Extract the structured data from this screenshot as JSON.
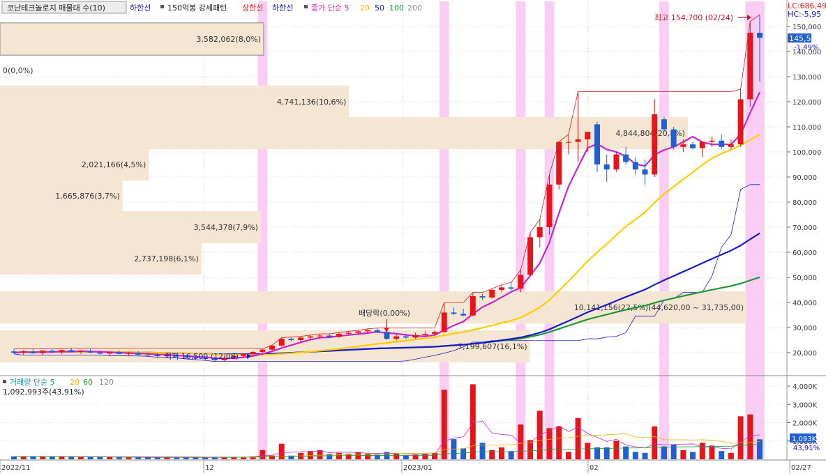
{
  "legend_main": {
    "title": "코난테크놀로지 매물대 수(10)",
    "item_low_line": "하한선",
    "item_150": "150억봉 강세패턴",
    "item_upper": "상한선",
    "item_lower": "하한선",
    "item_close": "종가 단순 5",
    "ma20": "20",
    "ma50": "50",
    "ma100": "100",
    "ma200": "200"
  },
  "legend_volume": {
    "title": "거래량 단순 5",
    "ma20": "20",
    "ma60": "60",
    "ma120": "120",
    "current": "1,092,993주(43,91%)"
  },
  "corner": {
    "lc": "LC:686,49",
    "hc": "HC:-5,95"
  },
  "price_axis": {
    "ticks": [
      "150,000",
      "140,000",
      "130,000",
      "120,000",
      "110,000",
      "100,000",
      "90,000",
      "80,000",
      "70,000",
      "60,000",
      "50,000",
      "40,000",
      "30,000",
      "20,000"
    ],
    "current_price": "145,500",
    "current_change": "-1,49%"
  },
  "volume_axis": {
    "ticks": [
      "4,000K",
      "3,000K",
      "2,000K",
      "1,000K"
    ],
    "current_volume": "1,093K",
    "current_pct": "43,91%"
  },
  "date_axis": {
    "labels": [
      "2022/11",
      "12",
      "2023/01",
      "02",
      "02/27"
    ]
  },
  "volume_profile_labels": [
    "3,582,062(8,0%)",
    "0(0,0%)",
    "4,741,136(10,6%)",
    "4,844,804(20,8%)",
    "2,021,166(4,5%)",
    "1,665,876(3,7%)",
    "3,544,378(7,9%)",
    "2,737,198(6,1%)",
    "10,141,156(22,5%)(44,620,00 ~ 31,735,00)",
    "7,199,607(16,1%)"
  ],
  "annotations": {
    "high": "최고 154,700 (02/24)",
    "low": "최저 16,500 (12/08)",
    "dividend": "배당락(0,00%)"
  },
  "colors": {
    "up": "#e8141a",
    "down": "#1f5fd1",
    "profile": "#f5e6d3",
    "highlight": "#f9c4f3",
    "ma5": "#cc22cc",
    "ma20": "#ffcc00",
    "ma50": "#1a1acc",
    "ma100": "#1a9933",
    "ma200": "#888888"
  },
  "chart_data": {
    "type": "candlestick",
    "date_range": [
      "2022/11",
      "02/27"
    ],
    "ylim": [
      15000,
      160000
    ],
    "volume_ylim": [
      0,
      4500
    ],
    "volume_unit": "K",
    "volume_profile": [
      {
        "price": 145000,
        "volume": 3582062,
        "pct": 8.0
      },
      {
        "price": 132500,
        "volume": 0,
        "pct": 0.0
      },
      {
        "price": 120000,
        "volume": 4741136,
        "pct": 10.6
      },
      {
        "price": 107500,
        "volume": 9344804,
        "pct": 20.8
      },
      {
        "price": 95000,
        "volume": 2021166,
        "pct": 4.5
      },
      {
        "price": 82500,
        "volume": 1665876,
        "pct": 3.7
      },
      {
        "price": 70000,
        "volume": 3544378,
        "pct": 7.9
      },
      {
        "price": 57500,
        "volume": 2737198,
        "pct": 6.1
      },
      {
        "price": 38000,
        "volume": 10141156,
        "pct": 22.5
      },
      {
        "price": 22500,
        "volume": 7199607,
        "pct": 16.1
      }
    ],
    "candles": [
      {
        "o": 20500,
        "h": 21500,
        "l": 19500,
        "c": 20000,
        "v": 150
      },
      {
        "o": 20000,
        "h": 21000,
        "l": 19000,
        "c": 20500,
        "v": 160
      },
      {
        "o": 20500,
        "h": 21500,
        "l": 19500,
        "c": 19800,
        "v": 140
      },
      {
        "o": 19800,
        "h": 21000,
        "l": 19000,
        "c": 20800,
        "v": 170
      },
      {
        "o": 20800,
        "h": 21500,
        "l": 19800,
        "c": 20200,
        "v": 130
      },
      {
        "o": 20200,
        "h": 21200,
        "l": 19500,
        "c": 21000,
        "v": 150
      },
      {
        "o": 21000,
        "h": 21800,
        "l": 20000,
        "c": 20300,
        "v": 140
      },
      {
        "o": 20300,
        "h": 21000,
        "l": 19500,
        "c": 20700,
        "v": 120
      },
      {
        "o": 20700,
        "h": 21500,
        "l": 19800,
        "c": 20000,
        "v": 130
      },
      {
        "o": 20000,
        "h": 20800,
        "l": 19200,
        "c": 19600,
        "v": 125
      },
      {
        "o": 19600,
        "h": 20500,
        "l": 18800,
        "c": 20200,
        "v": 115
      },
      {
        "o": 20200,
        "h": 20900,
        "l": 19300,
        "c": 19500,
        "v": 110
      },
      {
        "o": 19500,
        "h": 20300,
        "l": 18700,
        "c": 19900,
        "v": 105
      },
      {
        "o": 19900,
        "h": 20600,
        "l": 19000,
        "c": 19200,
        "v": 100
      },
      {
        "o": 19200,
        "h": 20000,
        "l": 18500,
        "c": 19000,
        "v": 95
      },
      {
        "o": 19000,
        "h": 19800,
        "l": 18200,
        "c": 18600,
        "v": 100
      },
      {
        "o": 18600,
        "h": 19500,
        "l": 17900,
        "c": 19100,
        "v": 110
      },
      {
        "o": 19100,
        "h": 19800,
        "l": 18300,
        "c": 18500,
        "v": 90
      },
      {
        "o": 18500,
        "h": 19200,
        "l": 17500,
        "c": 18100,
        "v": 100
      },
      {
        "o": 18100,
        "h": 18800,
        "l": 17200,
        "c": 17800,
        "v": 95
      },
      {
        "o": 17800,
        "h": 18500,
        "l": 16900,
        "c": 17600,
        "v": 90
      },
      {
        "o": 17600,
        "h": 18300,
        "l": 16500,
        "c": 17000,
        "v": 120
      },
      {
        "o": 17000,
        "h": 18200,
        "l": 16700,
        "c": 17900,
        "v": 110
      },
      {
        "o": 17900,
        "h": 18900,
        "l": 17400,
        "c": 18700,
        "v": 120
      },
      {
        "o": 18700,
        "h": 19800,
        "l": 18200,
        "c": 19500,
        "v": 130
      },
      {
        "o": 19500,
        "h": 20500,
        "l": 18900,
        "c": 20300,
        "v": 150
      },
      {
        "o": 20300,
        "h": 21500,
        "l": 19800,
        "c": 21200,
        "v": 500
      },
      {
        "o": 21200,
        "h": 23000,
        "l": 20800,
        "c": 22800,
        "v": 200
      },
      {
        "o": 22800,
        "h": 26000,
        "l": 22300,
        "c": 25500,
        "v": 850
      },
      {
        "o": 25500,
        "h": 26200,
        "l": 24500,
        "c": 25000,
        "v": 200
      },
      {
        "o": 25000,
        "h": 26500,
        "l": 24200,
        "c": 26000,
        "v": 350
      },
      {
        "o": 26000,
        "h": 27000,
        "l": 25000,
        "c": 26500,
        "v": 450
      },
      {
        "o": 26500,
        "h": 27500,
        "l": 25500,
        "c": 26800,
        "v": 500
      },
      {
        "o": 26800,
        "h": 27500,
        "l": 25800,
        "c": 26300,
        "v": 300
      },
      {
        "o": 26300,
        "h": 28000,
        "l": 25800,
        "c": 27500,
        "v": 350
      },
      {
        "o": 27500,
        "h": 28500,
        "l": 26800,
        "c": 27900,
        "v": 300
      },
      {
        "o": 27900,
        "h": 28900,
        "l": 27000,
        "c": 28500,
        "v": 400
      },
      {
        "o": 28500,
        "h": 29500,
        "l": 27500,
        "c": 29000,
        "v": 300
      },
      {
        "o": 29000,
        "h": 29800,
        "l": 27800,
        "c": 28300,
        "v": 250
      },
      {
        "o": 28300,
        "h": 28900,
        "l": 25000,
        "c": 25500,
        "v": 400
      },
      {
        "o": 25500,
        "h": 27500,
        "l": 24800,
        "c": 26500,
        "v": 300
      },
      {
        "o": 26500,
        "h": 27500,
        "l": 25500,
        "c": 26000,
        "v": 200
      },
      {
        "o": 26000,
        "h": 28000,
        "l": 25500,
        "c": 27000,
        "v": 250
      },
      {
        "o": 27000,
        "h": 28500,
        "l": 26200,
        "c": 27500,
        "v": 300
      },
      {
        "o": 27500,
        "h": 29000,
        "l": 26500,
        "c": 28200,
        "v": 350
      },
      {
        "o": 28200,
        "h": 40000,
        "l": 28000,
        "c": 36000,
        "v": 3800
      },
      {
        "o": 36000,
        "h": 38000,
        "l": 35000,
        "c": 35500,
        "v": 1100
      },
      {
        "o": 35500,
        "h": 37500,
        "l": 34500,
        "c": 34800,
        "v": 600
      },
      {
        "o": 34800,
        "h": 44000,
        "l": 34500,
        "c": 42500,
        "v": 4100
      },
      {
        "o": 42500,
        "h": 43500,
        "l": 41000,
        "c": 42000,
        "v": 900
      },
      {
        "o": 42000,
        "h": 45500,
        "l": 41500,
        "c": 45000,
        "v": 500
      },
      {
        "o": 45000,
        "h": 47000,
        "l": 44000,
        "c": 46000,
        "v": 650
      },
      {
        "o": 46000,
        "h": 48000,
        "l": 44500,
        "c": 45500,
        "v": 450
      },
      {
        "o": 45500,
        "h": 53000,
        "l": 44000,
        "c": 51000,
        "v": 1900
      },
      {
        "o": 51000,
        "h": 68000,
        "l": 50500,
        "c": 66000,
        "v": 1050
      },
      {
        "o": 66000,
        "h": 73000,
        "l": 62000,
        "c": 70000,
        "v": 2650
      },
      {
        "o": 70000,
        "h": 91000,
        "l": 67000,
        "c": 87000,
        "v": 1700
      },
      {
        "o": 87000,
        "h": 104000,
        "l": 85000,
        "c": 104000,
        "v": 1800
      },
      {
        "o": 104000,
        "h": 107000,
        "l": 99000,
        "c": 104000,
        "v": 400
      },
      {
        "o": 104000,
        "h": 124000,
        "l": 96000,
        "c": 105000,
        "v": 2250
      },
      {
        "o": 105000,
        "h": 108000,
        "l": 100000,
        "c": 108000,
        "v": 900
      },
      {
        "o": 111000,
        "h": 112000,
        "l": 92000,
        "c": 95000,
        "v": 650
      },
      {
        "o": 95000,
        "h": 99000,
        "l": 88000,
        "c": 93000,
        "v": 650
      },
      {
        "o": 93000,
        "h": 100000,
        "l": 92000,
        "c": 99000,
        "v": 1000
      },
      {
        "o": 99000,
        "h": 102000,
        "l": 95000,
        "c": 96000,
        "v": 700
      },
      {
        "o": 96000,
        "h": 98000,
        "l": 91000,
        "c": 93000,
        "v": 400
      },
      {
        "o": 93000,
        "h": 97000,
        "l": 87000,
        "c": 91000,
        "v": 350
      },
      {
        "o": 91000,
        "h": 121000,
        "l": 90000,
        "c": 115000,
        "v": 1800
      },
      {
        "o": 113000,
        "h": 114000,
        "l": 108000,
        "c": 109000,
        "v": 700
      },
      {
        "o": 109000,
        "h": 110000,
        "l": 101000,
        "c": 102000,
        "v": 800
      },
      {
        "o": 102000,
        "h": 105000,
        "l": 100000,
        "c": 103000,
        "v": 500
      },
      {
        "o": 103000,
        "h": 104000,
        "l": 101000,
        "c": 101500,
        "v": 400
      },
      {
        "o": 101500,
        "h": 104000,
        "l": 98000,
        "c": 104000,
        "v": 900
      },
      {
        "o": 104000,
        "h": 106000,
        "l": 102000,
        "c": 104500,
        "v": 750
      },
      {
        "o": 104500,
        "h": 107000,
        "l": 101000,
        "c": 102000,
        "v": 450
      },
      {
        "o": 102000,
        "h": 105000,
        "l": 101000,
        "c": 103000,
        "v": 350
      },
      {
        "o": 103000,
        "h": 125000,
        "l": 102000,
        "c": 121000,
        "v": 2350
      },
      {
        "o": 121000,
        "h": 152000,
        "l": 118000,
        "c": 147500,
        "v": 2450
      },
      {
        "o": 147500,
        "h": 154700,
        "l": 128000,
        "c": 145500,
        "v": 1093
      }
    ]
  }
}
